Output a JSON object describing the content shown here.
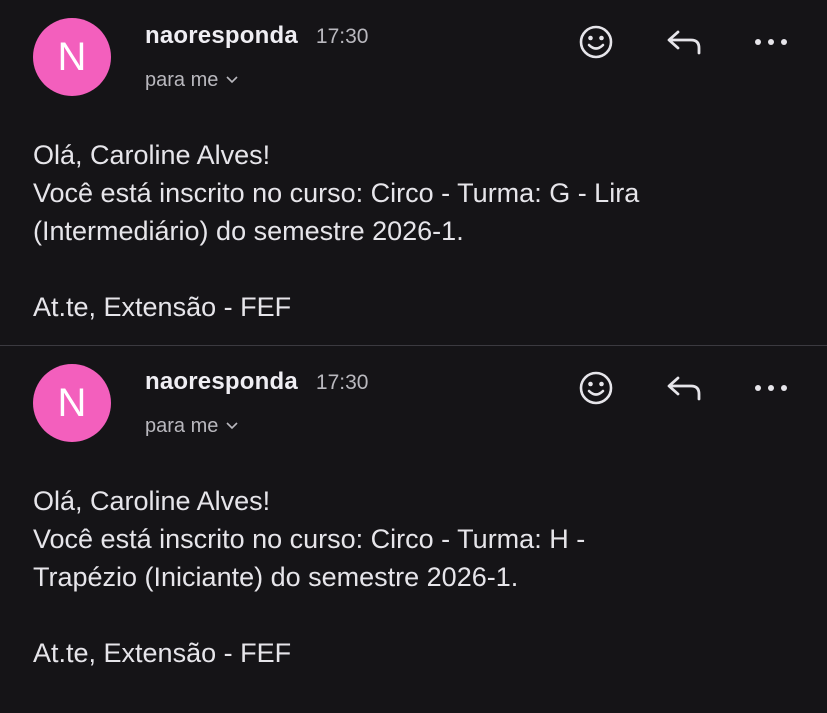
{
  "emails": [
    {
      "avatar_letter": "N",
      "sender": "naoresponda",
      "time": "17:30",
      "recipient": "para me",
      "greeting": "Olá, Caroline Alves!",
      "line1": "Você está inscrito no curso: Circo - Turma: G - Lira",
      "line2": "(Intermediário) do semestre 2026-1.",
      "signature": "At.te, Extensão - FEF"
    },
    {
      "avatar_letter": "N",
      "sender": "naoresponda",
      "time": "17:30",
      "recipient": "para me",
      "greeting": "Olá, Caroline Alves!",
      "line1": "Você está inscrito no curso: Circo - Turma: H -",
      "line2": "Trapézio (Iniciante) do semestre 2026-1.",
      "signature": "At.te, Extensão - FEF"
    }
  ],
  "colors": {
    "background": "#151417",
    "avatar": "#f35fbd",
    "text": "#e6e5ea",
    "muted": "#b9b8be"
  },
  "icons": [
    "emoji-icon",
    "reply-icon",
    "more-icon",
    "chevron-down-icon"
  ]
}
